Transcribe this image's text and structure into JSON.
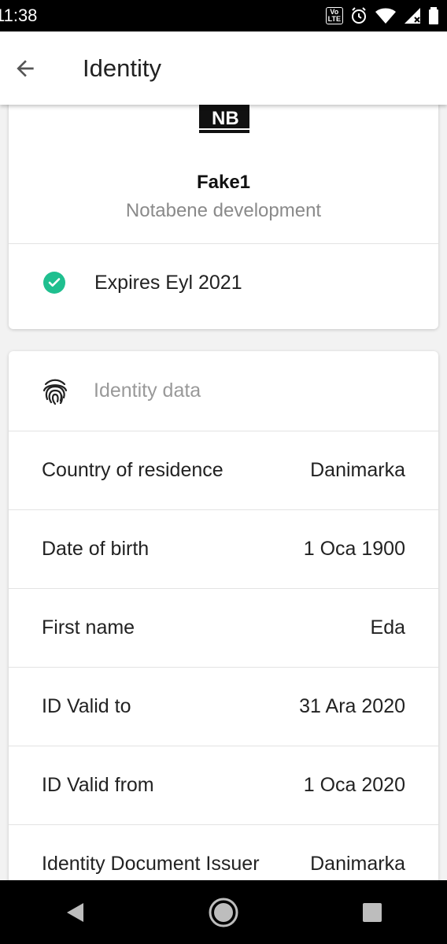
{
  "status_bar": {
    "time": "11:38",
    "volte_line1": "Vo",
    "volte_line2": "LTE"
  },
  "app_bar": {
    "title": "Identity"
  },
  "organization": {
    "name": "Fake1",
    "subtitle": "Notabene development",
    "logo_text": "NB"
  },
  "validity": {
    "text": "Expires Eyl 2021",
    "status_color": "#1fbf8f"
  },
  "identity_data": {
    "header": "Identity data",
    "rows": [
      {
        "label": "Country of residence",
        "value": "Danimarka"
      },
      {
        "label": "Date of birth",
        "value": "1 Oca 1900"
      },
      {
        "label": "First name",
        "value": "Eda"
      },
      {
        "label": "ID Valid to",
        "value": "31 Ara 2020"
      },
      {
        "label": "ID Valid from",
        "value": "1 Oca 2020"
      },
      {
        "label": "Identity Document Issuer",
        "value": "Danimarka"
      }
    ]
  },
  "icons": {
    "back": "arrow-back-icon",
    "check": "check-circle-icon",
    "fingerprint": "fingerprint-icon",
    "nav_back": "triangle-back-icon",
    "nav_home": "circle-home-icon",
    "nav_recents": "square-recents-icon"
  }
}
